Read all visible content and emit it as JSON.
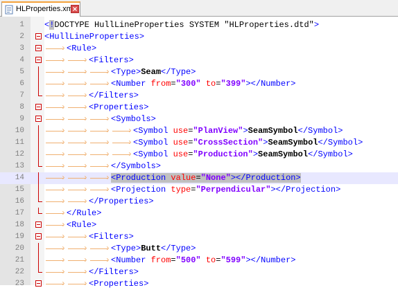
{
  "tab": {
    "label": "HLProperties.xml"
  },
  "lines": [
    {
      "n": "1",
      "ind": 0,
      "parts": [
        {
          "c": "b",
          "t": "<"
        },
        {
          "c": "sel-b",
          "t": "!"
        },
        {
          "c": "t",
          "t": "DOCTYPE HullLineProperties SYSTEM \"HLProperties.dtd\""
        },
        {
          "c": "b",
          "t": ">"
        }
      ]
    },
    {
      "n": "2",
      "ind": 0,
      "parts": [
        {
          "c": "b",
          "t": "<HullLineProperties>"
        }
      ]
    },
    {
      "n": "3",
      "ind": 1,
      "parts": [
        {
          "c": "b",
          "t": "<Rule>"
        }
      ]
    },
    {
      "n": "4",
      "ind": 2,
      "parts": [
        {
          "c": "b",
          "t": "<Filters>"
        }
      ]
    },
    {
      "n": "5",
      "ind": 3,
      "parts": [
        {
          "c": "b",
          "t": "<Type>"
        },
        {
          "c": "k",
          "t": "Seam"
        },
        {
          "c": "b",
          "t": "</Type>"
        }
      ]
    },
    {
      "n": "6",
      "ind": 3,
      "parts": [
        {
          "c": "b",
          "t": "<Number "
        },
        {
          "c": "a",
          "t": "from"
        },
        {
          "c": "t",
          "t": "="
        },
        {
          "c": "v",
          "t": "\"300\""
        },
        {
          "c": "t",
          "t": " "
        },
        {
          "c": "a",
          "t": "to"
        },
        {
          "c": "t",
          "t": "="
        },
        {
          "c": "v",
          "t": "\"399\""
        },
        {
          "c": "b",
          "t": "></Number>"
        }
      ]
    },
    {
      "n": "7",
      "ind": 2,
      "parts": [
        {
          "c": "b",
          "t": "</Filters>"
        }
      ]
    },
    {
      "n": "8",
      "ind": 2,
      "parts": [
        {
          "c": "b",
          "t": "<Properties>"
        }
      ]
    },
    {
      "n": "9",
      "ind": 3,
      "parts": [
        {
          "c": "b",
          "t": "<Symbols>"
        }
      ]
    },
    {
      "n": "10",
      "ind": 4,
      "parts": [
        {
          "c": "b",
          "t": "<Symbol "
        },
        {
          "c": "a",
          "t": "use"
        },
        {
          "c": "t",
          "t": "="
        },
        {
          "c": "v",
          "t": "\"PlanView\""
        },
        {
          "c": "b",
          "t": ">"
        },
        {
          "c": "k",
          "t": "SeamSymbol"
        },
        {
          "c": "b",
          "t": "</Symbol>"
        }
      ]
    },
    {
      "n": "11",
      "ind": 4,
      "parts": [
        {
          "c": "b",
          "t": "<Symbol "
        },
        {
          "c": "a",
          "t": "use"
        },
        {
          "c": "t",
          "t": "="
        },
        {
          "c": "v",
          "t": "\"CrossSection\""
        },
        {
          "c": "b",
          "t": ">"
        },
        {
          "c": "k",
          "t": "SeamSymbol"
        },
        {
          "c": "b",
          "t": "</Symbol>"
        }
      ]
    },
    {
      "n": "12",
      "ind": 4,
      "parts": [
        {
          "c": "b",
          "t": "<Symbol "
        },
        {
          "c": "a",
          "t": "use"
        },
        {
          "c": "t",
          "t": "="
        },
        {
          "c": "v",
          "t": "\"Production\""
        },
        {
          "c": "b",
          "t": ">"
        },
        {
          "c": "k",
          "t": "SeamSymbol"
        },
        {
          "c": "b",
          "t": "</Symbol>"
        }
      ]
    },
    {
      "n": "13",
      "ind": 3,
      "parts": [
        {
          "c": "b",
          "t": "</Symbols>"
        }
      ]
    },
    {
      "n": "14",
      "ind": 3,
      "current": true,
      "parts": [
        {
          "c": "b sel",
          "t": "<Production "
        },
        {
          "c": "a sel",
          "t": "value"
        },
        {
          "c": "t sel",
          "t": "="
        },
        {
          "c": "v sel",
          "t": "\"None\""
        },
        {
          "c": "b sel",
          "t": "></Production>"
        }
      ]
    },
    {
      "n": "15",
      "ind": 3,
      "parts": [
        {
          "c": "b",
          "t": "<Projection "
        },
        {
          "c": "a",
          "t": "type"
        },
        {
          "c": "t",
          "t": "="
        },
        {
          "c": "v",
          "t": "\"Perpendicular\""
        },
        {
          "c": "b",
          "t": "></Projection>"
        }
      ]
    },
    {
      "n": "16",
      "ind": 2,
      "parts": [
        {
          "c": "b",
          "t": "</Properties>"
        }
      ]
    },
    {
      "n": "17",
      "ind": 1,
      "parts": [
        {
          "c": "b",
          "t": "</Rule>"
        }
      ]
    },
    {
      "n": "18",
      "ind": 1,
      "parts": [
        {
          "c": "b",
          "t": "<Rule>"
        }
      ]
    },
    {
      "n": "19",
      "ind": 2,
      "parts": [
        {
          "c": "b",
          "t": "<Filters>"
        }
      ]
    },
    {
      "n": "20",
      "ind": 3,
      "parts": [
        {
          "c": "b",
          "t": "<Type>"
        },
        {
          "c": "k",
          "t": "Butt"
        },
        {
          "c": "b",
          "t": "</Type>"
        }
      ]
    },
    {
      "n": "21",
      "ind": 3,
      "parts": [
        {
          "c": "b",
          "t": "<Number "
        },
        {
          "c": "a",
          "t": "from"
        },
        {
          "c": "t",
          "t": "="
        },
        {
          "c": "v",
          "t": "\"500\""
        },
        {
          "c": "t",
          "t": " "
        },
        {
          "c": "a",
          "t": "to"
        },
        {
          "c": "t",
          "t": "="
        },
        {
          "c": "v",
          "t": "\"599\""
        },
        {
          "c": "b",
          "t": "></Number>"
        }
      ]
    },
    {
      "n": "22",
      "ind": 2,
      "parts": [
        {
          "c": "b",
          "t": "</Filters>"
        }
      ]
    },
    {
      "n": "23",
      "ind": 2,
      "parts": [
        {
          "c": "b",
          "t": "<Properties>"
        }
      ]
    }
  ],
  "folds": {
    "open": [
      "2",
      "3",
      "4",
      "8",
      "9",
      "18",
      "19",
      "23"
    ],
    "end": [
      "7",
      "13",
      "16",
      "17",
      "22"
    ],
    "line": [
      "5",
      "6",
      "10",
      "11",
      "12",
      "14",
      "15",
      "20",
      "21"
    ]
  },
  "colors": {
    "tag": "#0000ff",
    "attr": "#ff0000",
    "value": "#8000ff",
    "fold": "#cc0000",
    "current_line": "#e8e8ff"
  }
}
